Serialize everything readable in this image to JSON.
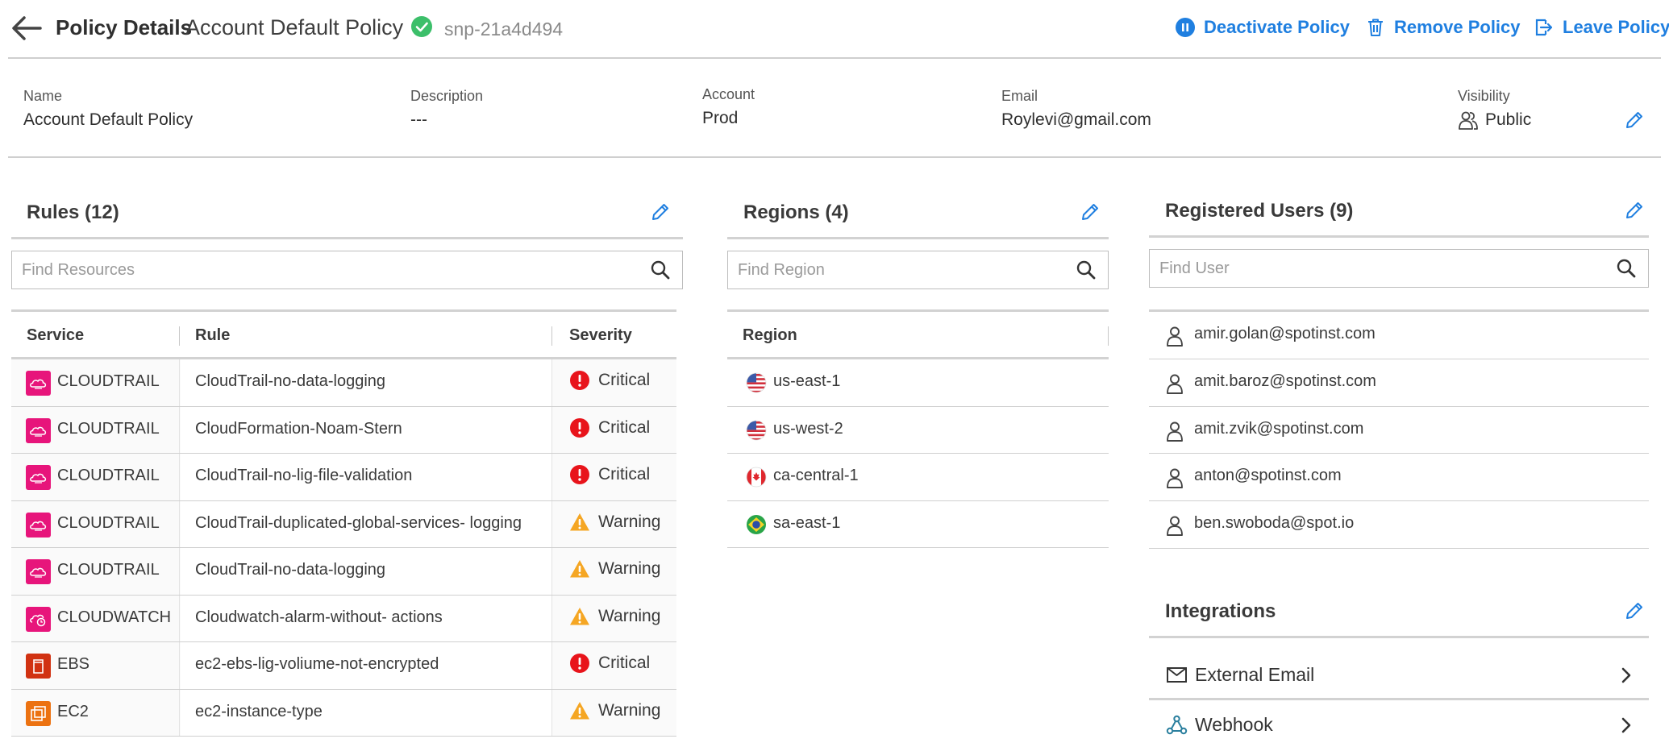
{
  "header": {
    "title": "Policy Details",
    "policy_name": "Account Default Policy",
    "policy_id": "snp-21a4d494",
    "actions": {
      "deactivate": "Deactivate Policy",
      "remove": "Remove Policy",
      "leave": "Leave Policy"
    }
  },
  "info": {
    "name_label": "Name",
    "name_value": "Account Default Policy",
    "description_label": "Description",
    "description_value": "---",
    "account_label": "Account",
    "account_value": "Prod",
    "email_label": "Email",
    "email_value": "Roylevi@gmail.com",
    "visibility_label": "Visibility",
    "visibility_value": "Public"
  },
  "rules": {
    "title": "Rules (12)",
    "search_placeholder": "Find Resources",
    "columns": {
      "service": "Service",
      "rule": "Rule",
      "severity": "Severity"
    },
    "rows": [
      {
        "service": "CLOUDTRAIL",
        "icon": "cloudtrail-icon",
        "rule": "CloudTrail-no-data-logging",
        "severity": "Critical"
      },
      {
        "service": "CLOUDTRAIL",
        "icon": "cloudtrail-icon",
        "rule": "CloudFormation-Noam-Stern",
        "severity": "Critical"
      },
      {
        "service": "CLOUDTRAIL",
        "icon": "cloudtrail-icon",
        "rule": "CloudTrail-no-lig-file-validation",
        "severity": "Critical"
      },
      {
        "service": "CLOUDTRAIL",
        "icon": "cloudtrail-icon",
        "rule": "CloudTrail-duplicated-global-services- logging",
        "severity": "Warning"
      },
      {
        "service": "CLOUDTRAIL",
        "icon": "cloudtrail-icon",
        "rule": "CloudTrail-no-data-logging",
        "severity": "Warning"
      },
      {
        "service": "CLOUDWATCH",
        "icon": "cloudwatch-icon",
        "rule": "Cloudwatch-alarm-without- actions",
        "severity": "Warning"
      },
      {
        "service": "EBS",
        "icon": "ebs-icon",
        "rule": "ec2-ebs-lig-voliume-not-encrypted",
        "severity": "Critical"
      },
      {
        "service": "EC2",
        "icon": "ec2-icon",
        "rule": "ec2-instance-type",
        "severity": "Warning"
      }
    ]
  },
  "regions": {
    "title": "Regions (4)",
    "search_placeholder": "Find Region",
    "column": "Region",
    "rows": [
      {
        "name": "us-east-1",
        "flag": "us-flag-icon"
      },
      {
        "name": "us-west-2",
        "flag": "us-flag-icon"
      },
      {
        "name": "ca-central-1",
        "flag": "ca-flag-icon"
      },
      {
        "name": "sa-east-1",
        "flag": "br-flag-icon"
      }
    ]
  },
  "users": {
    "title": "Registered Users (9)",
    "search_placeholder": "Find User",
    "rows": [
      "amir.golan@spotinst.com",
      "amit.baroz@spotinst.com",
      "amit.zvik@spotinst.com",
      "anton@spotinst.com",
      "ben.swoboda@spot.io"
    ]
  },
  "integrations": {
    "title": "Integrations",
    "items": [
      {
        "label": "External Email",
        "icon": "envelope-icon"
      },
      {
        "label": "Webhook",
        "icon": "webhook-icon"
      }
    ]
  },
  "colors": {
    "accent": "#1f7fe0",
    "success": "#3cbf6a",
    "critical": "#e8141b",
    "warning": "#f5a623",
    "cloudtrail": "#e7157b",
    "ebs": "#d13212",
    "ec2": "#ec7211"
  }
}
